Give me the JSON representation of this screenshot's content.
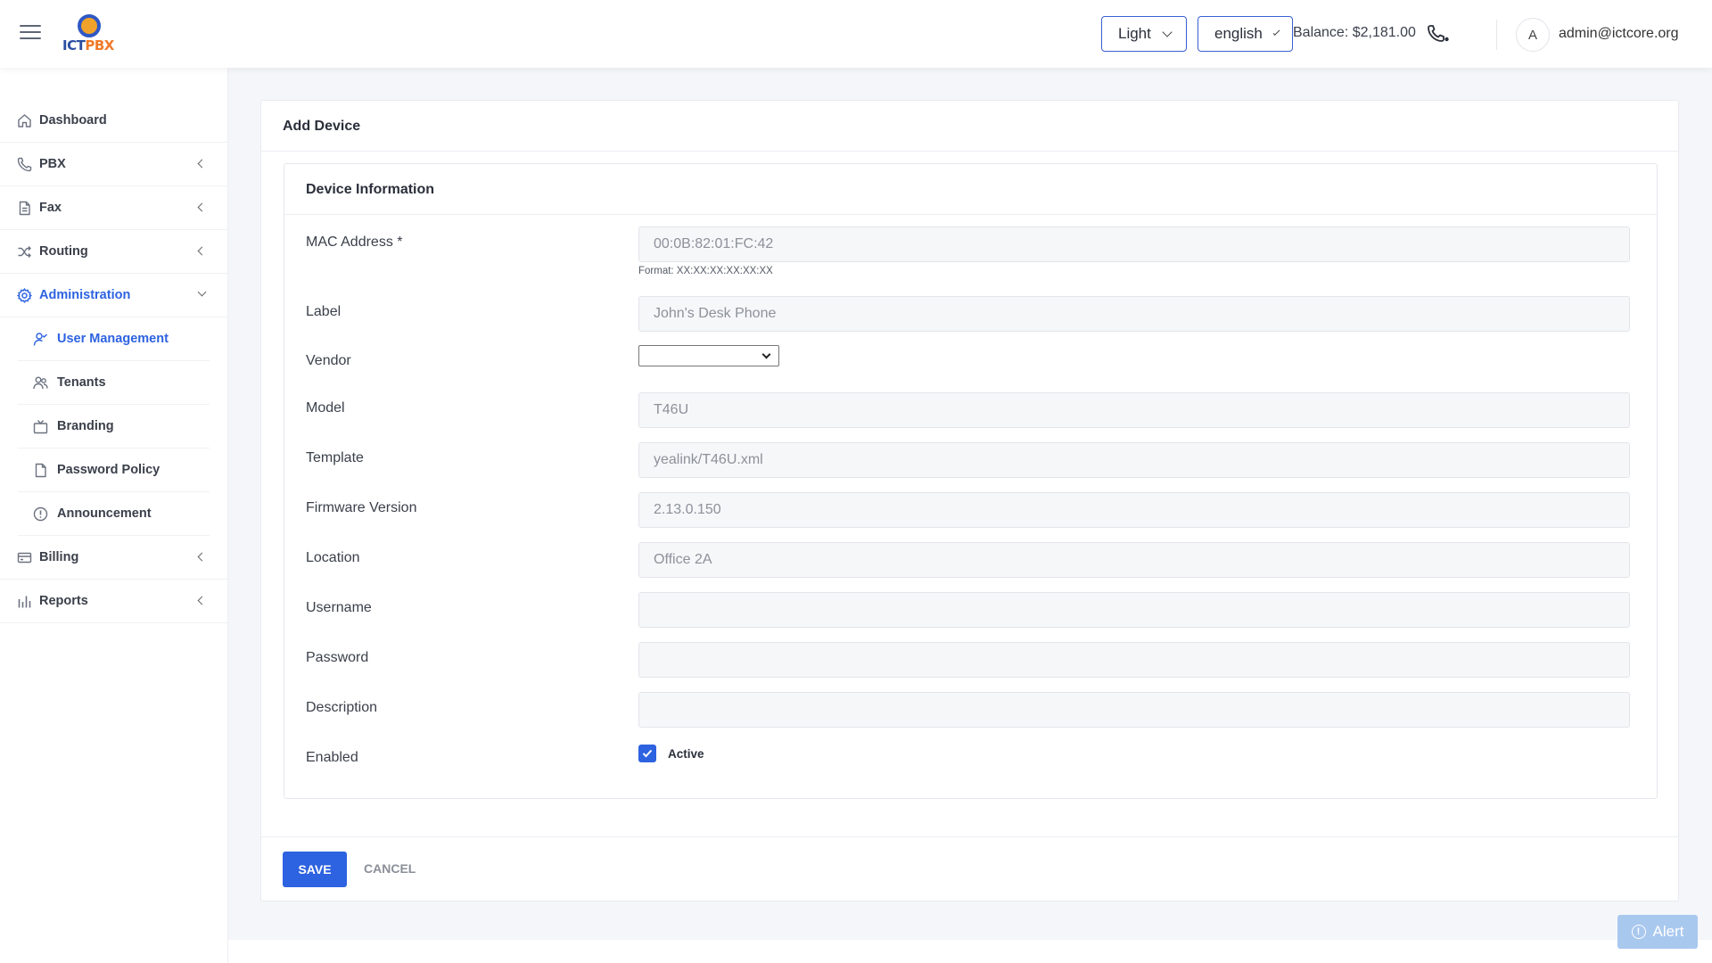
{
  "header": {
    "theme_value": "Light",
    "language_value": "english",
    "balance": "Balance: $2,181.00",
    "avatar_initial": "A",
    "user_email": "admin@ictcore.org",
    "logo_text_main": "ICT",
    "logo_text_accent": "PBX"
  },
  "sidebar": {
    "dashboard": "Dashboard",
    "pbx": "PBX",
    "fax": "Fax",
    "routing": "Routing",
    "administration": "Administration",
    "user_management": "User Management",
    "tenants": "Tenants",
    "branding": "Branding",
    "password_policy": "Password Policy",
    "announcement": "Announcement",
    "billing": "Billing",
    "reports": "Reports"
  },
  "page": {
    "title": "Add Device",
    "section_title": "Device Information"
  },
  "form": {
    "mac_label": "MAC Address *",
    "mac_value": "00:0B:82:01:FC:42",
    "mac_hint": "Format: XX:XX:XX:XX:XX:XX",
    "label_label": "Label",
    "label_value": "John's Desk Phone",
    "vendor_label": "Vendor",
    "vendor_value": "",
    "model_label": "Model",
    "model_value": "T46U",
    "template_label": "Template",
    "template_value": "yealink/T46U.xml",
    "firmware_label": "Firmware Version",
    "firmware_value": "2.13.0.150",
    "location_label": "Location",
    "location_value": "Office 2A",
    "username_label": "Username",
    "username_value": "",
    "password_label": "Password",
    "password_value": "",
    "description_label": "Description",
    "description_value": "",
    "enabled_label": "Enabled",
    "enabled_checked": true,
    "enabled_option": "Active"
  },
  "actions": {
    "save": "SAVE",
    "cancel": "CANCEL",
    "alert": "Alert"
  },
  "colors": {
    "accent": "#2d62e0",
    "alert_bg": "#a9c8ee"
  }
}
